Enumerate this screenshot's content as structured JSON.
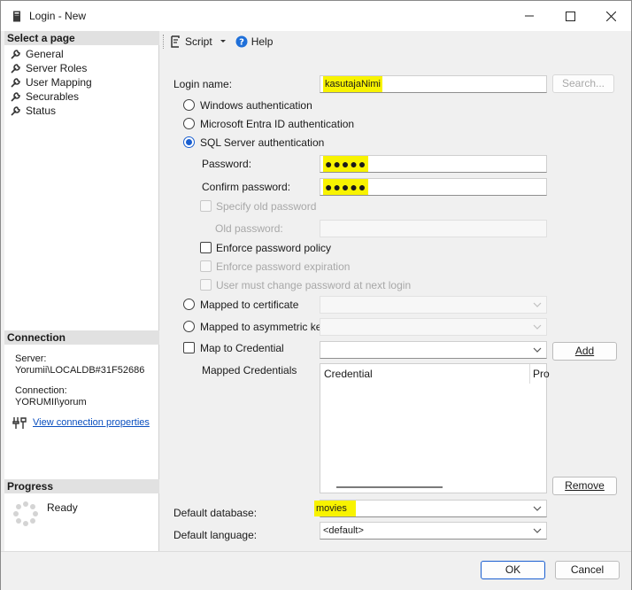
{
  "window": {
    "title": "Login - New"
  },
  "left": {
    "select_page_header": "Select a page",
    "pages": [
      {
        "label": "General"
      },
      {
        "label": "Server Roles"
      },
      {
        "label": "User Mapping"
      },
      {
        "label": "Securables"
      },
      {
        "label": "Status"
      }
    ],
    "connection_header": "Connection",
    "server_label": "Server:",
    "server_value": "Yorumii\\LOCALDB#31F52686",
    "connection_label": "Connection:",
    "connection_value": "YORUMII\\yorum",
    "view_props_link": "View connection properties",
    "progress_header": "Progress",
    "progress_status": "Ready"
  },
  "toolbar": {
    "script_label": "Script",
    "help_label": "Help"
  },
  "form": {
    "login_name_label": "Login name:",
    "login_name_value": "kasutajaNimi",
    "search_button": "Search...",
    "windows_auth": "Windows authentication",
    "entra_auth": "Microsoft Entra ID authentication",
    "sql_auth": "SQL Server authentication",
    "password_label": "Password:",
    "password_value": "●●●●●",
    "confirm_label": "Confirm password:",
    "confirm_value": "●●●●●",
    "specify_old": "Specify old password",
    "old_password_label": "Old password:",
    "enforce_policy": "Enforce password policy",
    "enforce_expiration": "Enforce password expiration",
    "must_change": "User must change password at next login",
    "mapped_cert": "Mapped to certificate",
    "mapped_asym": "Mapped to asymmetric key",
    "map_credential": "Map to Credential",
    "add_button": "Add",
    "mapped_credentials_label": "Mapped Credentials",
    "grid_col_credential": "Credential",
    "grid_col_provider": "Pro",
    "remove_button": "Remove",
    "default_db_label": "Default database:",
    "default_db_value": "movies",
    "default_lang_label": "Default language:",
    "default_lang_value": "<default>"
  },
  "buttons": {
    "ok": "OK",
    "cancel": "Cancel"
  },
  "colors": {
    "highlight": "#f8f300",
    "accent": "#1a5fd0",
    "link": "#0a4fbf"
  }
}
